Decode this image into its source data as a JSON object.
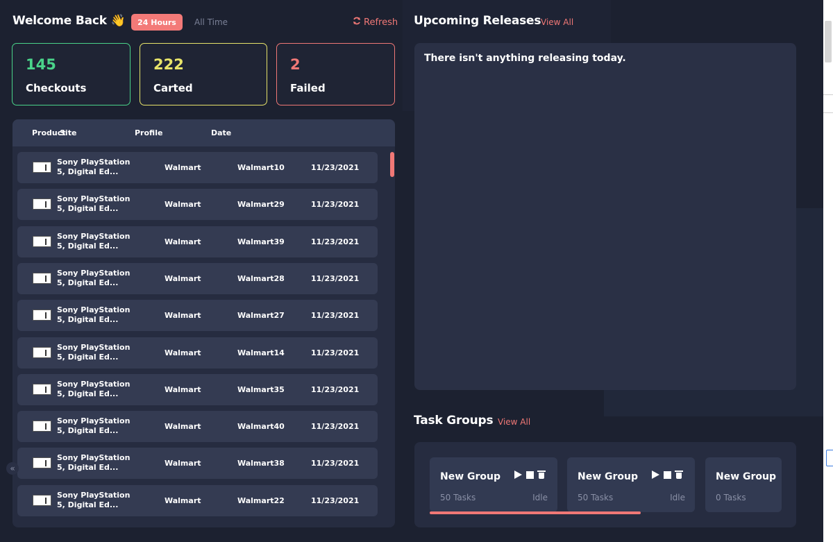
{
  "header": {
    "welcome": "Welcome Back 👋",
    "range_active": "24 Hours",
    "range_other": "All Time",
    "refresh": "Refresh"
  },
  "stats": [
    {
      "value": "145",
      "label": "Checkouts",
      "color": "#4ad48a"
    },
    {
      "value": "222",
      "label": "Carted",
      "color": "#e8e46a"
    },
    {
      "value": "2",
      "label": "Failed",
      "color": "#f07876"
    }
  ],
  "table": {
    "headers": [
      "Product",
      "Site",
      "Profile",
      "Date"
    ],
    "rows": [
      {
        "product": "Sony PlayStation 5, Digital Ed...",
        "site": "Walmart",
        "profile": "Walmart10",
        "date": "11/23/2021"
      },
      {
        "product": "Sony PlayStation 5, Digital Ed...",
        "site": "Walmart",
        "profile": "Walmart29",
        "date": "11/23/2021"
      },
      {
        "product": "Sony PlayStation 5, Digital Ed...",
        "site": "Walmart",
        "profile": "Walmart39",
        "date": "11/23/2021"
      },
      {
        "product": "Sony PlayStation 5, Digital Ed...",
        "site": "Walmart",
        "profile": "Walmart28",
        "date": "11/23/2021"
      },
      {
        "product": "Sony PlayStation 5, Digital Ed...",
        "site": "Walmart",
        "profile": "Walmart27",
        "date": "11/23/2021"
      },
      {
        "product": "Sony PlayStation 5, Digital Ed...",
        "site": "Walmart",
        "profile": "Walmart14",
        "date": "11/23/2021"
      },
      {
        "product": "Sony PlayStation 5, Digital Ed...",
        "site": "Walmart",
        "profile": "Walmart35",
        "date": "11/23/2021"
      },
      {
        "product": "Sony PlayStation 5, Digital Ed...",
        "site": "Walmart",
        "profile": "Walmart40",
        "date": "11/23/2021"
      },
      {
        "product": "Sony PlayStation 5, Digital Ed...",
        "site": "Walmart",
        "profile": "Walmart38",
        "date": "11/23/2021"
      },
      {
        "product": "Sony PlayStation 5, Digital Ed...",
        "site": "Walmart",
        "profile": "Walmart22",
        "date": "11/23/2021"
      }
    ]
  },
  "releases": {
    "title": "Upcoming Releases",
    "view_all": "View All",
    "empty_message": "There isn't anything releasing today."
  },
  "task_groups": {
    "title": "Task Groups",
    "view_all": "View All",
    "progress_fraction": 0.6,
    "groups": [
      {
        "name": "New Group",
        "tasks": "50 Tasks",
        "status": "Idle",
        "controls": [
          "play-icon",
          "stop-icon",
          "trash-icon"
        ]
      },
      {
        "name": "New Group",
        "tasks": "50 Tasks",
        "status": "Idle",
        "controls": [
          "play-icon",
          "stop-icon",
          "trash-icon"
        ]
      },
      {
        "name": "New Group",
        "tasks": "0 Tasks",
        "status": "",
        "controls": []
      }
    ]
  },
  "colors": {
    "accent": "#f07876",
    "background": "#1c2130",
    "panel": "#262c40"
  }
}
